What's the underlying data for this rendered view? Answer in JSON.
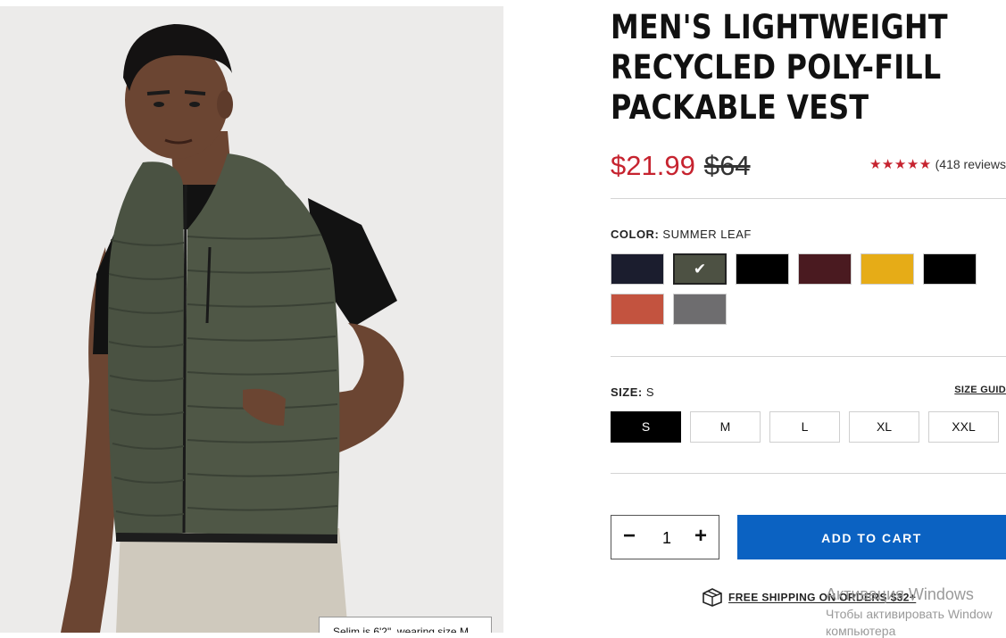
{
  "product": {
    "title_lines": [
      "MEN'S LIGHTWEIGHT",
      "RECYCLED POLY-FILL",
      "PACKABLE VEST"
    ],
    "sale_price": "$21.99",
    "original_price": "$64",
    "stars": "★★★★★",
    "reviews": "(418 reviews",
    "model_caption": "Selim is 6'2\", wearing size M"
  },
  "color": {
    "label": "COLOR:",
    "selected": "SUMMER LEAF",
    "check": "✔",
    "swatches": [
      {
        "name": "navy",
        "hex": "#1b1d2e"
      },
      {
        "name": "summer leaf",
        "hex": "#4d5143"
      },
      {
        "name": "black",
        "hex": "#000000"
      },
      {
        "name": "burgundy",
        "hex": "#4a1a20"
      },
      {
        "name": "yellow",
        "hex": "#e6ac17"
      },
      {
        "name": "black",
        "hex": "#000000"
      },
      {
        "name": "rust",
        "hex": "#c3533f"
      },
      {
        "name": "gray",
        "hex": "#6e6d6f"
      }
    ]
  },
  "size": {
    "label": "SIZE:",
    "selected": "S",
    "guide": "SIZE GUID",
    "options": [
      "S",
      "M",
      "L",
      "XL",
      "XXL"
    ]
  },
  "cart": {
    "minus": "−",
    "plus": "+",
    "quantity": "1",
    "button": "ADD TO CART"
  },
  "shipping": {
    "icon": "box-icon",
    "text": "FREE SHIPPING ON ORDERS $32+"
  },
  "watermark": {
    "line1": "Активация Windows",
    "line2": "Чтобы активировать Window",
    "line3": "компьютера"
  },
  "colors": {
    "sale": "#c6232f",
    "cart_button": "#0b62c2",
    "vest": "#4a5242"
  }
}
